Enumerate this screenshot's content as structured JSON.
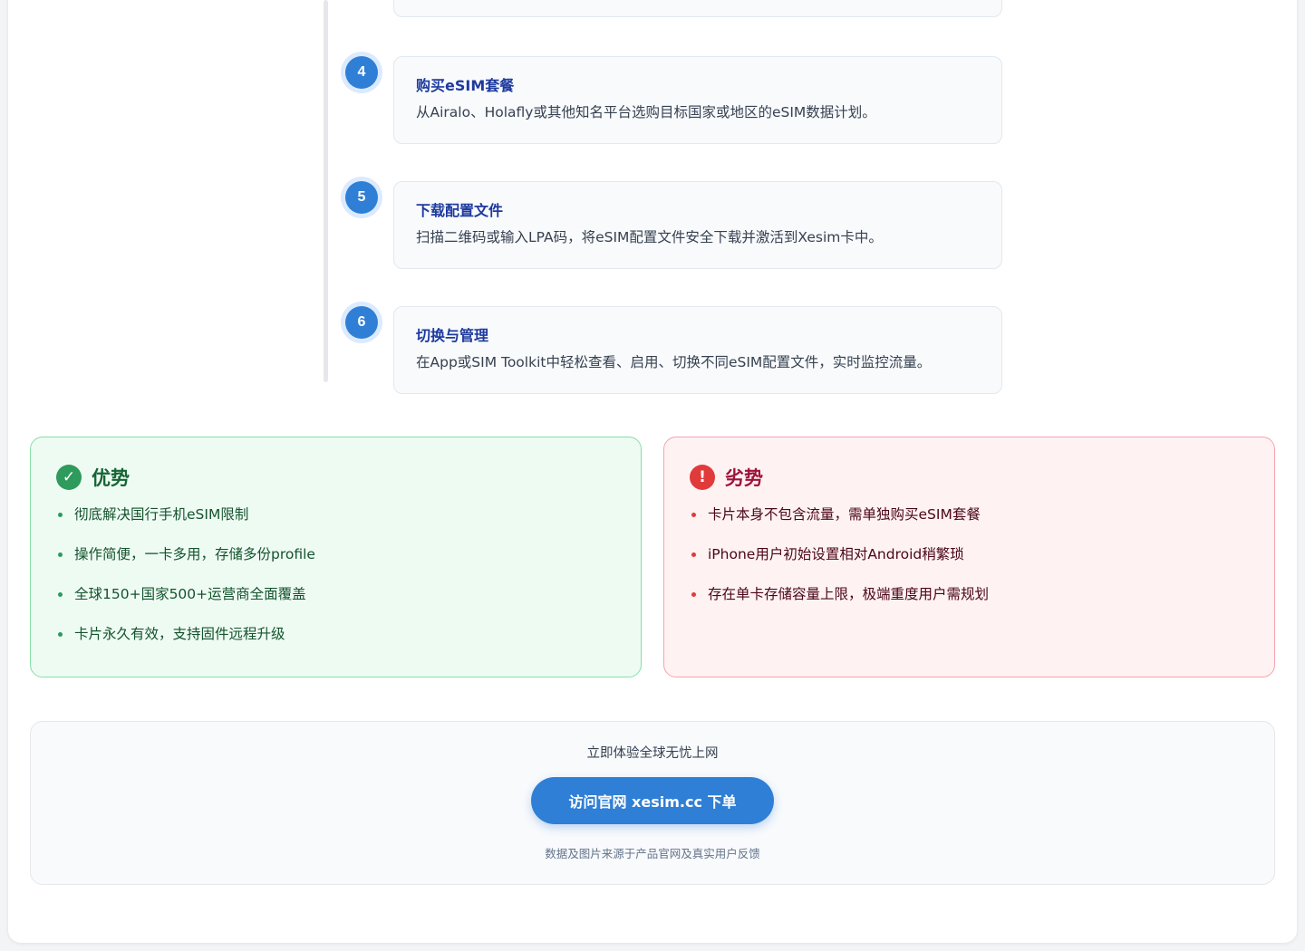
{
  "steps": [
    {
      "number": "4",
      "title": "购买eSIM套餐",
      "description": "从Airalo、Holafly或其他知名平台选购目标国家或地区的eSIM数据计划。"
    },
    {
      "number": "5",
      "title": "下载配置文件",
      "description": "扫描二维码或输入LPA码，将eSIM配置文件安全下载并激活到Xesim卡中。"
    },
    {
      "number": "6",
      "title": "切换与管理",
      "description": "在App或SIM Toolkit中轻松查看、启用、切换不同eSIM配置文件，实时监控流量。"
    }
  ],
  "pros": {
    "icon": "check-icon",
    "icon_glyph": "✓",
    "title": "优势",
    "items": [
      "彻底解决国行手机eSIM限制",
      "操作简便，一卡多用，存储多份profile",
      "全球150+国家500+运营商全面覆盖",
      "卡片永久有效，支持固件远程升级"
    ]
  },
  "cons": {
    "icon": "alert-icon",
    "icon_glyph": "!",
    "title": "劣势",
    "items": [
      "卡片本身不包含流量，需单独购买eSIM套餐",
      "iPhone用户初始设置相对Android稍繁琐",
      "存在单卡存储容量上限，极端重度用户需规划"
    ]
  },
  "cta": {
    "text": "立即体验全球无忧上网",
    "button_label": "访问官网 xesim.cc 下单",
    "note": "数据及图片来源于产品官网及真实用户反馈"
  },
  "colors": {
    "accent": "#2f7fd6",
    "pros": "#2e9a5c",
    "cons": "#e13a3a"
  }
}
